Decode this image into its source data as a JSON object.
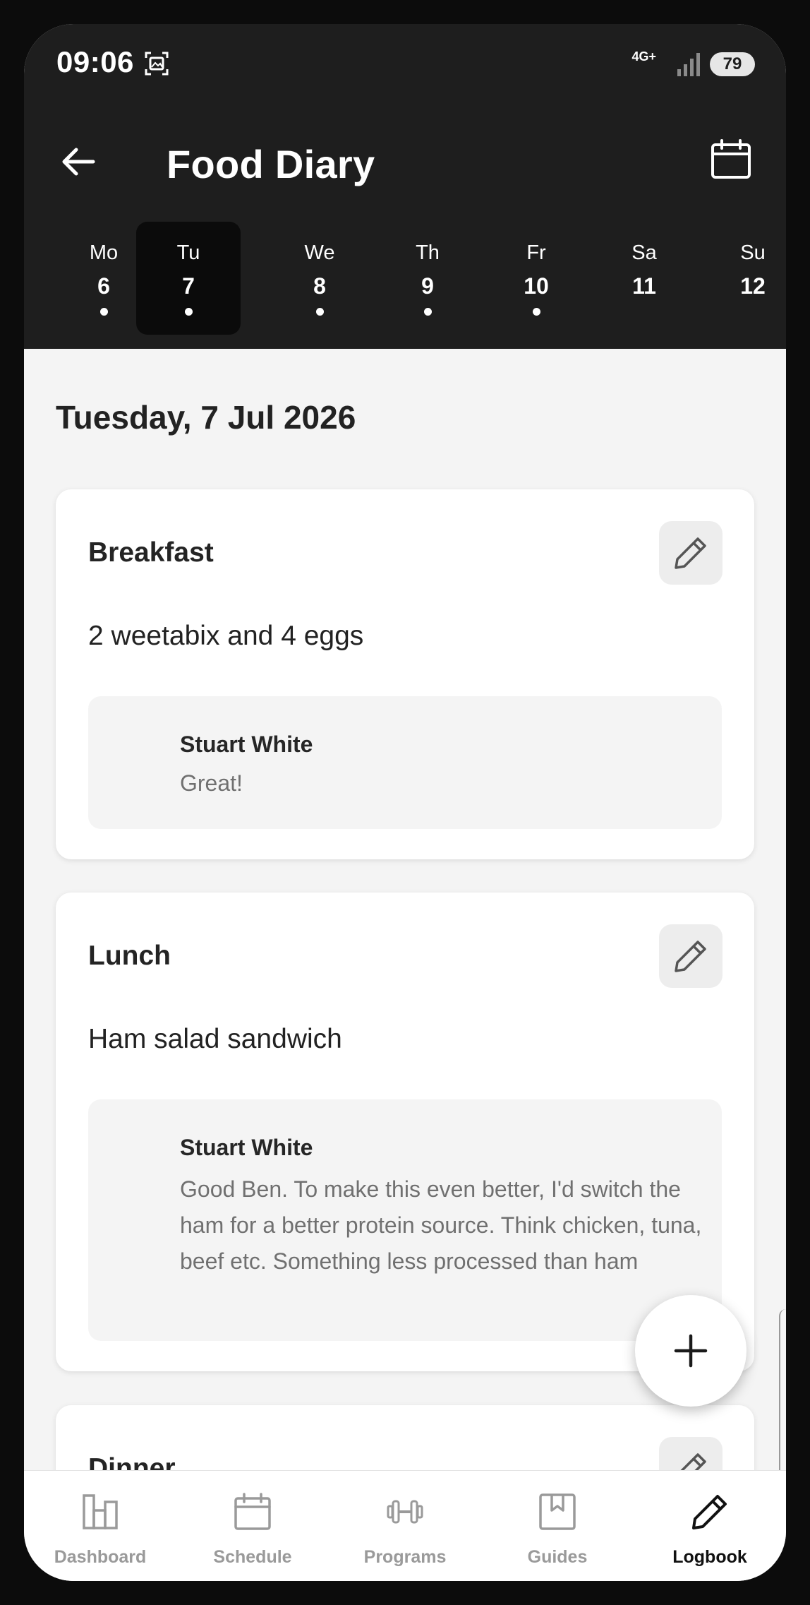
{
  "status_bar": {
    "time": "09:06",
    "network": "4G+",
    "battery": "79"
  },
  "header": {
    "title": "Food Diary",
    "back_icon": "arrow-left-icon",
    "calendar_icon": "calendar-icon"
  },
  "week": [
    {
      "name": "Mo",
      "date": "6",
      "has_entry": true,
      "selected": false
    },
    {
      "name": "Tu",
      "date": "7",
      "has_entry": true,
      "selected": true
    },
    {
      "name": "We",
      "date": "8",
      "has_entry": true,
      "selected": false
    },
    {
      "name": "Th",
      "date": "9",
      "has_entry": true,
      "selected": false
    },
    {
      "name": "Fr",
      "date": "10",
      "has_entry": true,
      "selected": false
    },
    {
      "name": "Sa",
      "date": "11",
      "has_entry": false,
      "selected": false
    },
    {
      "name": "Su",
      "date": "12",
      "has_entry": false,
      "selected": false
    }
  ],
  "date_heading": "Tuesday, 7 Jul 2026",
  "meals": [
    {
      "title": "Breakfast",
      "description": "2 weetabix and 4 eggs",
      "comment": {
        "author": "Stuart White",
        "text": "Great!"
      }
    },
    {
      "title": "Lunch",
      "description": "Ham salad sandwich",
      "comment": {
        "author": "Stuart White",
        "text": "Good Ben. To make this even better, I'd switch the ham for a better protein source. Think chicken, tuna, beef etc. Something less processed than ham"
      }
    },
    {
      "title": "Dinner"
    }
  ],
  "fab_icon": "plus-icon",
  "bottom_nav": [
    {
      "label": "Dashboard",
      "icon": "dashboard-icon",
      "active": false
    },
    {
      "label": "Schedule",
      "icon": "calendar-icon",
      "active": false
    },
    {
      "label": "Programs",
      "icon": "dumbbell-icon",
      "active": false
    },
    {
      "label": "Guides",
      "icon": "bookmark-book-icon",
      "active": false
    },
    {
      "label": "Logbook",
      "icon": "pencil-icon",
      "active": true
    }
  ],
  "colors": {
    "header_bg": "#1e1e1e",
    "selected_day_bg": "#0b0b0b",
    "page_bg": "#f4f4f4",
    "nav_inactive": "#9a9a9a",
    "nav_active": "#111111"
  }
}
